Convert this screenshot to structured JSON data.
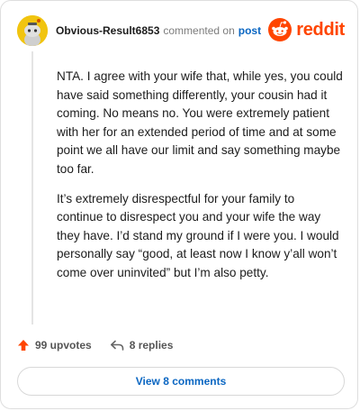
{
  "header": {
    "username": "Obvious-Result6853",
    "commented_on": "commented on",
    "post_link": "post",
    "brand": "reddit"
  },
  "comment": {
    "paragraphs": [
      "NTA. I agree with your wife that, while yes, you could have said something differently, your cousin had it coming. No means no. You were extremely patient with her for an extended period of time and at some point we all have our limit and say something maybe too far.",
      "It’s extremely disrespectful for your family to continue to disrespect you and your wife the way they have. I’d stand my ground if I were you. I would personally say “good, at least now I know y’all won’t come over uninvited” but I’m also petty."
    ]
  },
  "actions": {
    "upvotes": "99 upvotes",
    "replies": "8 replies"
  },
  "view_button": "View 8 comments",
  "colors": {
    "brand": "#ff4500",
    "link": "#0a66c2",
    "avatar": "#f1c40f"
  },
  "icons": [
    "avatar-snoo-icon",
    "reddit-logo-icon",
    "upvote-arrow-icon",
    "reply-arrow-icon"
  ]
}
